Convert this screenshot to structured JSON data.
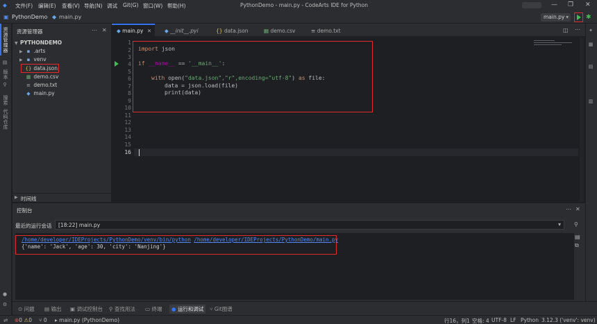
{
  "titlebar": {
    "menus": [
      "文件(F)",
      "编辑(E)",
      "查看(V)",
      "导航(N)",
      "调试",
      "Git(G)",
      "窗口(W)",
      "帮助(H)"
    ],
    "window_title": "PythonDemo - main.py - CodeArts IDE for Python"
  },
  "navbar": {
    "project": "PythonDemo",
    "file": "main.py",
    "run_config": "main.py"
  },
  "leftbar": {
    "items": [
      "资源管理器",
      "版本",
      "搜索",
      "代码仓库"
    ]
  },
  "explorer": {
    "title": "资源管理器",
    "project": "PYTHONDEMO",
    "items": [
      {
        "label": ".arts",
        "icon": "folder-icon"
      },
      {
        "label": "venv",
        "icon": "folder-icon"
      },
      {
        "label": "data.json",
        "icon": "json-icon"
      },
      {
        "label": "demo.csv",
        "icon": "csv-icon"
      },
      {
        "label": "demo.txt",
        "icon": "txt-icon"
      },
      {
        "label": "main.py",
        "icon": "python-icon"
      }
    ],
    "timeline": "时间线"
  },
  "tabs": [
    {
      "label": "main.py",
      "active": true
    },
    {
      "label": "__init__.pyi",
      "active": false
    },
    {
      "label": "data.json",
      "active": false
    },
    {
      "label": "demo.csv",
      "active": false
    },
    {
      "label": "demo.txt",
      "active": false
    }
  ],
  "editor": {
    "line_numbers": [
      "1",
      "2",
      "3",
      "4",
      "5",
      "6",
      "7",
      "8",
      "9",
      "10",
      "11",
      "12",
      "13",
      "14",
      "15",
      "16"
    ],
    "code": {
      "l1_kw": "import",
      "l1_mod": " json",
      "l4_kw": "if",
      "l4_name": " __name__",
      "l4_eq": " == ",
      "l4_str": "'__main__'",
      "l4_colon": ":",
      "l6_with": "with",
      "l6_open": " open(",
      "l6_args": "\"data.json\",\"r\",encoding=\"utf-8\"",
      "l6_close": ") ",
      "l6_as": "as",
      "l6_file": " file:",
      "l7": "data = json.load(file)",
      "l8": "print(data)"
    },
    "cursor_line": "16"
  },
  "console": {
    "title": "控制台",
    "recent_label": "最近的运行会话",
    "session": "[18:22] main.py",
    "output_link1": "/home/developer/IDEProjects/PythonDemo/venv/bin/python",
    "output_link2": "/home/developer/IDEProjects/PythonDemo/main.py",
    "output_result": "{'name': 'Jack', 'age': 30, 'city': 'Nanjing'}"
  },
  "tool_windows": [
    "问题",
    "输出",
    "调试控制台",
    "查找用法",
    "终端",
    "运行和调试",
    "Git图谱"
  ],
  "statusbar": {
    "errors": "0",
    "warnings": "0",
    "git": "0",
    "run_info": "main.py (PythonDemo)",
    "position": "行16，列1",
    "spaces": "空格: 4",
    "encoding": "UTF-8",
    "eol": "LF",
    "language": "Python",
    "interpreter": "3.12.3 ('venv': venv)"
  },
  "colors": {
    "accent": "#3574f0",
    "highlight_box": "#e02b2b",
    "run_green": "#3fbf4f"
  }
}
